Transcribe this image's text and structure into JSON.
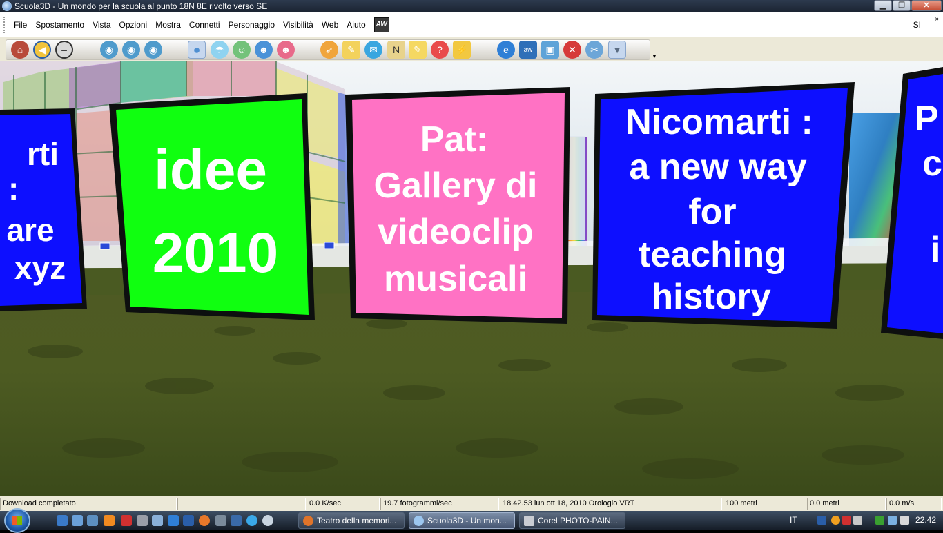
{
  "window": {
    "title": "Scuola3D  - Un mondo per la scuola al punto 18N 8E  rivolto verso SE",
    "buttons": {
      "minimize": "▁",
      "maximize": "❐",
      "close": "✕"
    }
  },
  "menubar": {
    "items": [
      "File",
      "Spostamento",
      "Vista",
      "Opzioni",
      "Mostra",
      "Connetti",
      "Personaggio",
      "Visibilità",
      "Web",
      "Aiuto"
    ],
    "logo": "AW",
    "right_label": "SI",
    "overflow": "»"
  },
  "toolbar": {
    "icons": [
      "home-icon",
      "back-icon",
      "stop-icon",
      "eye-1st-person-icon",
      "eye-3rd-person-icon",
      "eye-view-icon",
      "avatar-icon",
      "teleport-icon",
      "user-icon",
      "contacts-icon",
      "group-icon",
      "rocket-icon",
      "pencil-icon",
      "chat-bubble-icon",
      "notes-icon",
      "edit-icon",
      "help-icon",
      "lightning-icon",
      "internet-explorer-icon",
      "aw-icon",
      "camera-icon",
      "block-icon",
      "tools-icon",
      "shirt-icon"
    ],
    "colors": {
      "accent": "#3e86d4"
    }
  },
  "scene": {
    "boards": [
      {
        "lines": [
          "rti",
          ":",
          "are",
          "xyz"
        ],
        "bg": "#0d0fff",
        "fg": "#ffffff"
      },
      {
        "lines": [
          "idee",
          "2010"
        ],
        "bg": "#10ff10",
        "fg": "#ffffff"
      },
      {
        "lines": [
          "Pat:",
          "Gallery di",
          "videoclip",
          "musicali"
        ],
        "bg": "#ff72c4",
        "fg": "#ffffff"
      },
      {
        "lines": [
          "Nicomarti :",
          "a new way",
          "for",
          "teaching",
          "history"
        ],
        "bg": "#0d0fff",
        "fg": "#ffffff"
      },
      {
        "lines": [
          "P",
          "c",
          "i"
        ],
        "bg": "#0d0fff",
        "fg": "#ffffff"
      }
    ]
  },
  "statusbar": {
    "download": "Download completato",
    "empty": "",
    "speed": "0.0 K/sec",
    "fps": "19.7 fotogrammi/sec",
    "clock": "18.42.53 lun ott 18, 2010 Orologio VRT",
    "distance": "100 metri",
    "altitude": "0.0 metri",
    "velocity": "0.0 m/s"
  },
  "taskbar": {
    "tasks": [
      {
        "label": "Teatro della memori...",
        "color": "#e0742a"
      },
      {
        "label": "Scuola3D  - Un mon...",
        "color": "#9cc6ef"
      },
      {
        "label": "Corel PHOTO-PAIN...",
        "color": "#c9ccd2"
      }
    ],
    "tray": {
      "lang": "IT",
      "time": "22.42"
    }
  }
}
